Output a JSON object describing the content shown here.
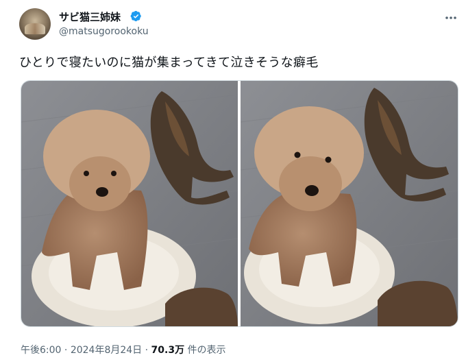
{
  "user": {
    "display_name": "サビ猫三姉妹",
    "handle": "@matsugorookoku",
    "avatar_icon": "user-avatar",
    "verified_icon": "verified-badge-icon",
    "verified_color": "#1d9bf0"
  },
  "tweet": {
    "text": "ひとりで寝たいのに猫が集まってきて泣きそうな癖毛"
  },
  "media": {
    "photos": [
      {
        "icon": "dog-on-cushion-photo"
      },
      {
        "icon": "dog-on-cushion-photo"
      }
    ]
  },
  "meta": {
    "time": "午後6:00",
    "separator": " · ",
    "date": "2024年8月24日",
    "views_count": "70.3万",
    "views_label": " 件の表示"
  },
  "colors": {
    "text_primary": "#0f1419",
    "text_secondary": "#536471",
    "border": "#cfd9de"
  }
}
